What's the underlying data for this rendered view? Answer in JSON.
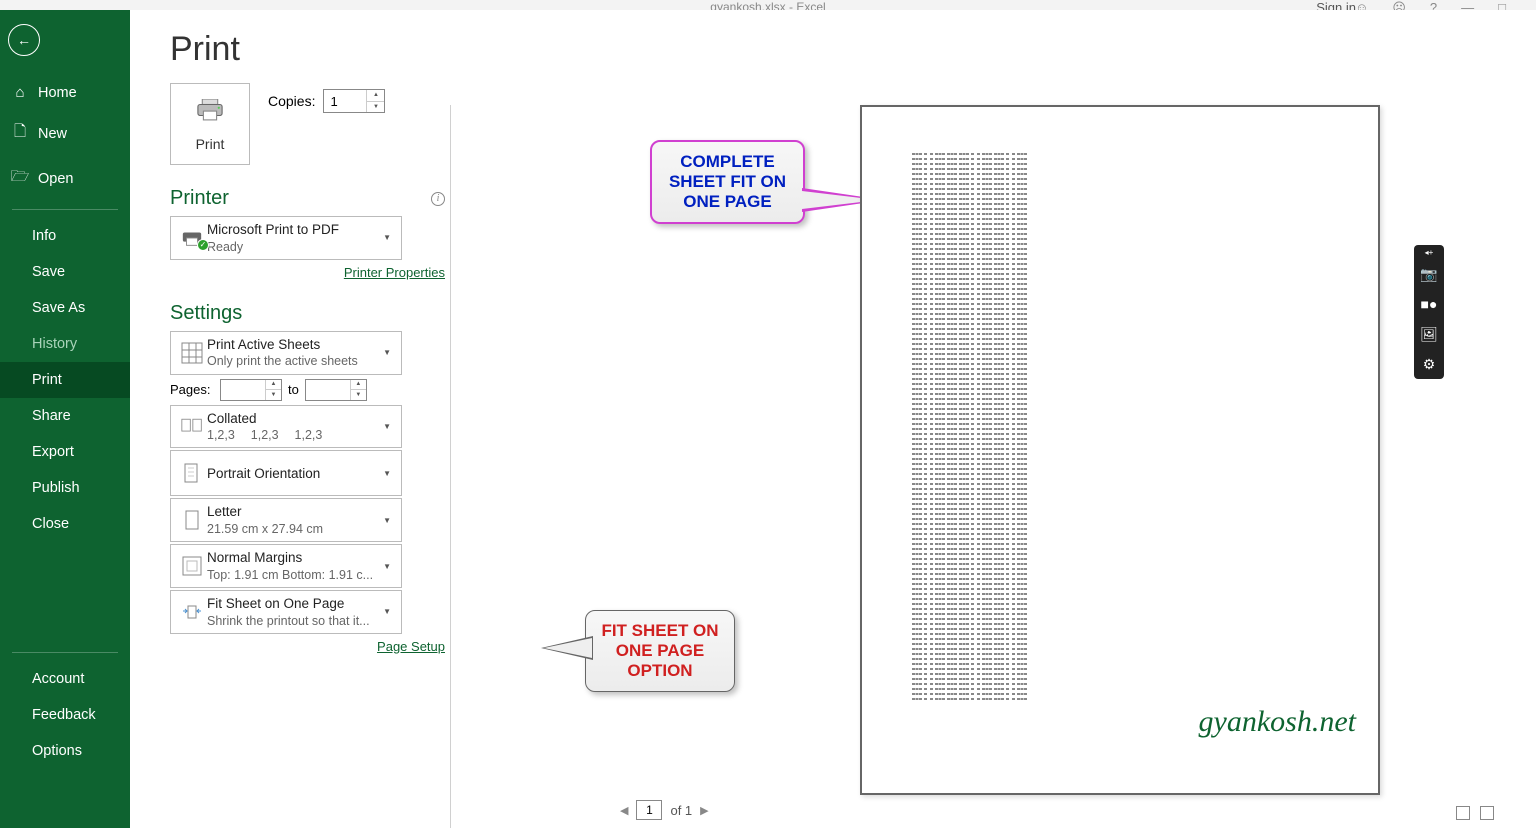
{
  "title": "gyankosh.xlsx  -  Excel",
  "signin": "Sign in",
  "sidebar": {
    "home": "Home",
    "new": "New",
    "open": "Open",
    "info": "Info",
    "save": "Save",
    "saveas": "Save As",
    "history": "History",
    "print": "Print",
    "share": "Share",
    "export": "Export",
    "publish": "Publish",
    "close": "Close",
    "account": "Account",
    "feedback": "Feedback",
    "options": "Options"
  },
  "print": {
    "heading": "Print",
    "button": "Print",
    "copies_label": "Copies:",
    "copies_value": "1",
    "printer_heading": "Printer",
    "printer_name": "Microsoft Print to PDF",
    "printer_status": "Ready",
    "printer_props": "Printer Properties",
    "settings_heading": "Settings",
    "s1_title": "Print Active Sheets",
    "s1_sub": "Only print the active sheets",
    "pages_label": "Pages:",
    "pages_to": "to",
    "s2_title": "Collated",
    "s2_sub": "1,2,3  1,2,3  1,2,3",
    "s3_title": "Portrait Orientation",
    "s4_title": "Letter",
    "s4_sub": "21.59 cm x 27.94 cm",
    "s5_title": "Normal Margins",
    "s5_sub": "Top: 1.91 cm Bottom: 1.91 c...",
    "s6_title": "Fit Sheet on One Page",
    "s6_sub": "Shrink the printout so that it...",
    "page_setup": "Page Setup"
  },
  "callouts": {
    "c1": "COMPLETE SHEET FIT ON ONE PAGE",
    "c2": "FIT SHEET ON ONE PAGE OPTION"
  },
  "watermark": "gyankosh.net",
  "pagenav": {
    "current": "1",
    "of": "of 1"
  }
}
